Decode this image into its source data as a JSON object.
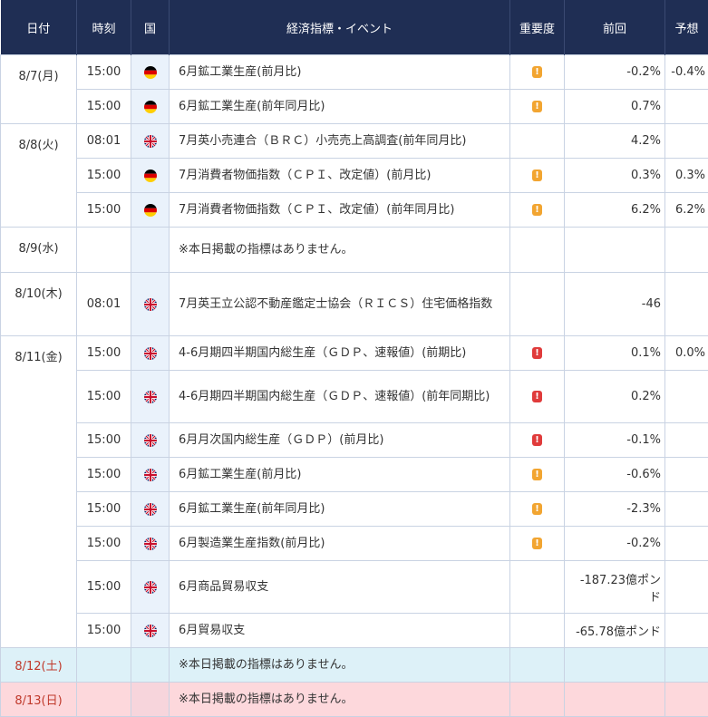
{
  "headers": {
    "date": "日付",
    "time": "時刻",
    "country": "国",
    "event": "経済指標・イベント",
    "importance": "重要度",
    "previous": "前回",
    "forecast": "予想"
  },
  "rows": [
    {
      "date": "8/7(月)",
      "time": "15:00",
      "country": "germany",
      "event": "6月鉱工業生産(前月比)",
      "importance": "mid",
      "previous": "-0.2%",
      "forecast": "-0.4%"
    },
    {
      "date": "",
      "time": "15:00",
      "country": "germany",
      "event": "6月鉱工業生産(前年同月比)",
      "importance": "mid",
      "previous": "0.7%",
      "forecast": ""
    },
    {
      "date": "8/8(火)",
      "time": "08:01",
      "country": "uk",
      "event": "7月英小売連合（ＢＲＣ）小売売上高調査(前年同月比)",
      "importance": "",
      "previous": "4.2%",
      "forecast": ""
    },
    {
      "date": "",
      "time": "15:00",
      "country": "germany",
      "event": "7月消費者物価指数（ＣＰＩ、改定値）(前月比)",
      "importance": "mid",
      "previous": "0.3%",
      "forecast": "0.3%"
    },
    {
      "date": "",
      "time": "15:00",
      "country": "germany",
      "event": "7月消費者物価指数（ＣＰＩ、改定値）(前年同月比)",
      "importance": "mid",
      "previous": "6.2%",
      "forecast": "6.2%"
    },
    {
      "date": "8/9(水)",
      "time": "",
      "country": "",
      "event": "※本日掲載の指標はありません。",
      "importance": "",
      "previous": "",
      "forecast": ""
    },
    {
      "date": "8/10(木)",
      "time": "08:01",
      "country": "uk",
      "event": "7月英王立公認不動産鑑定士協会（ＲＩＣＳ）住宅価格指数",
      "importance": "",
      "previous": "-46",
      "forecast": ""
    },
    {
      "date": "8/11(金)",
      "time": "15:00",
      "country": "uk",
      "event": "4-6月期四半期国内総生産（ＧＤＰ、速報値）(前期比)",
      "importance": "high",
      "previous": "0.1%",
      "forecast": "0.0%"
    },
    {
      "date": "",
      "time": "15:00",
      "country": "uk",
      "event": "4-6月期四半期国内総生産（ＧＤＰ、速報値）(前年同期比)",
      "importance": "high",
      "previous": "0.2%",
      "forecast": ""
    },
    {
      "date": "",
      "time": "15:00",
      "country": "uk",
      "event": "6月月次国内総生産（ＧＤＰ）(前月比)",
      "importance": "high",
      "previous": "-0.1%",
      "forecast": ""
    },
    {
      "date": "",
      "time": "15:00",
      "country": "uk",
      "event": "6月鉱工業生産(前月比)",
      "importance": "mid",
      "previous": "-0.6%",
      "forecast": ""
    },
    {
      "date": "",
      "time": "15:00",
      "country": "uk",
      "event": "6月鉱工業生産(前年同月比)",
      "importance": "mid",
      "previous": "-2.3%",
      "forecast": ""
    },
    {
      "date": "",
      "time": "15:00",
      "country": "uk",
      "event": "6月製造業生産指数(前月比)",
      "importance": "mid",
      "previous": "-0.2%",
      "forecast": ""
    },
    {
      "date": "",
      "time": "15:00",
      "country": "uk",
      "event": "6月商品貿易収支",
      "importance": "",
      "previous": "-187.23億ポンド",
      "forecast": ""
    },
    {
      "date": "",
      "time": "15:00",
      "country": "uk",
      "event": "6月貿易収支",
      "importance": "",
      "previous": "-65.78億ポンド",
      "forecast": ""
    },
    {
      "date": "8/12(土)",
      "time": "",
      "country": "",
      "event": "※本日掲載の指標はありません。",
      "importance": "",
      "previous": "",
      "forecast": ""
    },
    {
      "date": "8/13(日)",
      "time": "",
      "country": "",
      "event": "※本日掲載の指標はありません。",
      "importance": "",
      "previous": "",
      "forecast": ""
    }
  ],
  "colors": {
    "header_bg": "#1f2e54",
    "importance_mid": "#f2a531",
    "importance_high": "#e03b3b",
    "saturday_bg": "#ddf1f8",
    "sunday_bg": "#fdd8dc",
    "weekend_date": "#c0392b"
  }
}
